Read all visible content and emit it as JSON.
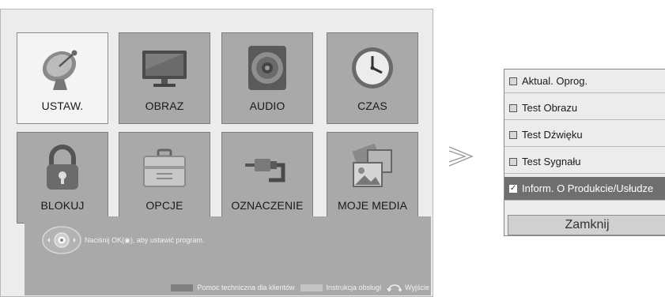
{
  "main_menu": {
    "tiles": [
      {
        "label": "USTAW.",
        "icon": "satellite-dish-icon",
        "selected": true
      },
      {
        "label": "OBRAZ",
        "icon": "tv-monitor-icon",
        "selected": false
      },
      {
        "label": "AUDIO",
        "icon": "speaker-icon",
        "selected": false
      },
      {
        "label": "CZAS",
        "icon": "clock-icon",
        "selected": false
      },
      {
        "label": "BLOKUJ",
        "icon": "padlock-icon",
        "selected": false
      },
      {
        "label": "OPCJE",
        "icon": "toolbox-icon",
        "selected": false
      },
      {
        "label": "OZNACZENIE",
        "icon": "cable-connector-icon",
        "selected": false
      },
      {
        "label": "MOJE MEDIA",
        "icon": "media-photos-icon",
        "selected": false
      }
    ]
  },
  "help": {
    "instruction": "Naciśnij OK(◉), aby ustawić program.",
    "customer_support": "Pomoc techniczna dla klientów",
    "manual": "Instrukcja obsługi",
    "exit": "Wyjście"
  },
  "support_menu": {
    "items": [
      {
        "label": "Aktual. Oprog.",
        "checked": false,
        "highlighted": false
      },
      {
        "label": "Test Obrazu",
        "checked": false,
        "highlighted": false
      },
      {
        "label": "Test Dźwięku",
        "checked": false,
        "highlighted": false
      },
      {
        "label": "Test Sygnału",
        "checked": false,
        "highlighted": false
      },
      {
        "label": "Inform. O Produkcie/Usłudze",
        "checked": true,
        "highlighted": true
      }
    ],
    "close_label": "Zamknij"
  },
  "colors": {
    "tile": "#a9a9a9",
    "tile_selected": "#f4f4f4",
    "highlight": "#6f6f6f",
    "swatch_dark": "#808080",
    "swatch_light": "#c4c4c4"
  }
}
